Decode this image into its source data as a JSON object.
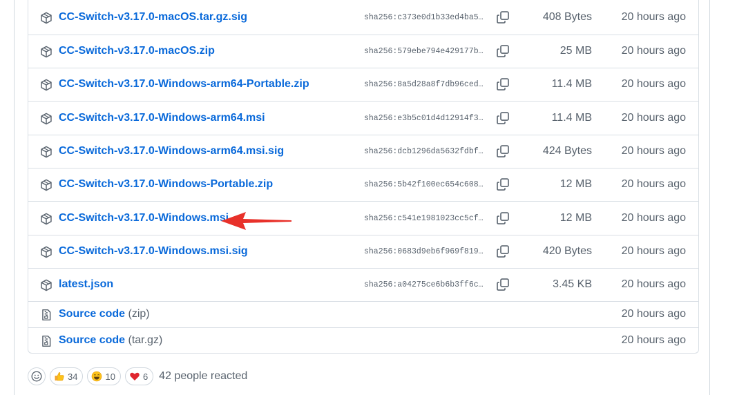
{
  "assets": [
    {
      "name": "CC-Switch-v3.17.0-macOS.tar.gz.sig",
      "sha": "sha256:c373e0d1b33ed4ba5…",
      "size": "408 Bytes",
      "time": "20 hours ago",
      "icon": "package-icon"
    },
    {
      "name": "CC-Switch-v3.17.0-macOS.zip",
      "sha": "sha256:579ebe794e429177b…",
      "size": "25 MB",
      "time": "20 hours ago",
      "icon": "package-icon"
    },
    {
      "name": "CC-Switch-v3.17.0-Windows-arm64-Portable.zip",
      "sha": "sha256:8a5d28a8f7db96ced…",
      "size": "11.4 MB",
      "time": "20 hours ago",
      "icon": "package-icon"
    },
    {
      "name": "CC-Switch-v3.17.0-Windows-arm64.msi",
      "sha": "sha256:e3b5c01d4d12914f3…",
      "size": "11.4 MB",
      "time": "20 hours ago",
      "icon": "package-icon"
    },
    {
      "name": "CC-Switch-v3.17.0-Windows-arm64.msi.sig",
      "sha": "sha256:dcb1296da5632fdbf…",
      "size": "424 Bytes",
      "time": "20 hours ago",
      "icon": "package-icon"
    },
    {
      "name": "CC-Switch-v3.17.0-Windows-Portable.zip",
      "sha": "sha256:5b42f100ec654c608…",
      "size": "12 MB",
      "time": "20 hours ago",
      "icon": "package-icon"
    },
    {
      "name": "CC-Switch-v3.17.0-Windows.msi",
      "sha": "sha256:c541e1981023cc5cf…",
      "size": "12 MB",
      "time": "20 hours ago",
      "icon": "package-icon"
    },
    {
      "name": "CC-Switch-v3.17.0-Windows.msi.sig",
      "sha": "sha256:0683d9eb6f969f819…",
      "size": "420 Bytes",
      "time": "20 hours ago",
      "icon": "package-icon"
    },
    {
      "name": "latest.json",
      "sha": "sha256:a04275ce6b6b3ff6c…",
      "size": "3.45 KB",
      "time": "20 hours ago",
      "icon": "package-icon"
    }
  ],
  "source_code": [
    {
      "label": "Source code",
      "suffix": "(zip)",
      "time": "20 hours ago",
      "icon": "file-zip-icon"
    },
    {
      "label": "Source code",
      "suffix": "(tar.gz)",
      "time": "20 hours ago",
      "icon": "file-zip-icon"
    }
  ],
  "reactions": {
    "thumbs_up": "34",
    "laugh": "10",
    "heart": "6",
    "summary": "42 people reacted"
  },
  "colors": {
    "link": "#0969da",
    "muted": "#59636e",
    "border": "#d8dee4",
    "arrow": "#e8312a"
  }
}
